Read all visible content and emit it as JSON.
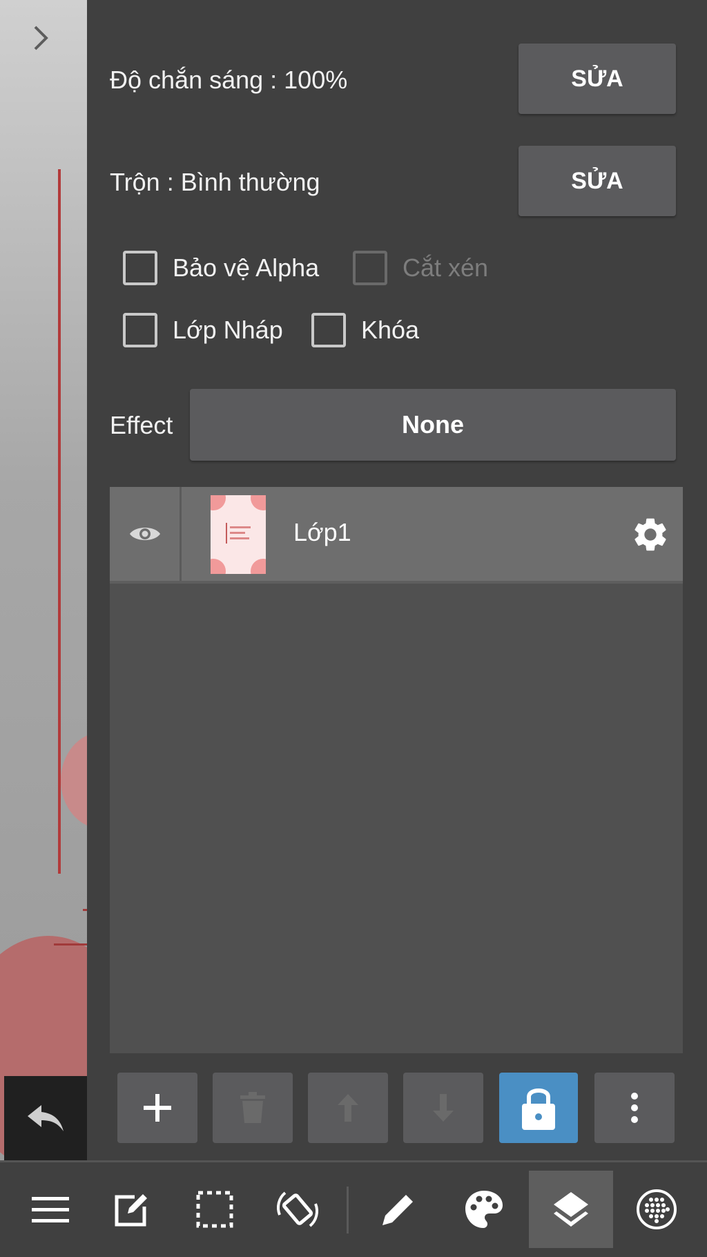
{
  "properties": {
    "opacity_label": "Độ chắn sáng : 100%",
    "blend_label": "Trộn : Bình thường",
    "edit_label": "SỬA"
  },
  "options": {
    "protect_alpha": "Bảo vệ Alpha",
    "clipping": "Cắt xén",
    "draft_layer": "Lớp Nháp",
    "lock": "Khóa"
  },
  "effect": {
    "label": "Effect",
    "value": "None"
  },
  "layers": [
    {
      "name": "Lớp1"
    }
  ],
  "colors": {
    "accent": "#4a8fc4",
    "panel": "#404040",
    "button": "#5b5b5d"
  },
  "icons": {
    "layer_tools": [
      "plus-icon",
      "trash-icon",
      "arrow-up-icon",
      "arrow-down-icon",
      "lock-icon",
      "more-vert-icon"
    ],
    "bottom_nav": [
      "menu-icon",
      "edit-icon",
      "selection-icon",
      "rotate-icon",
      "pen-icon",
      "palette-icon",
      "layers-icon",
      "materials-icon"
    ]
  }
}
